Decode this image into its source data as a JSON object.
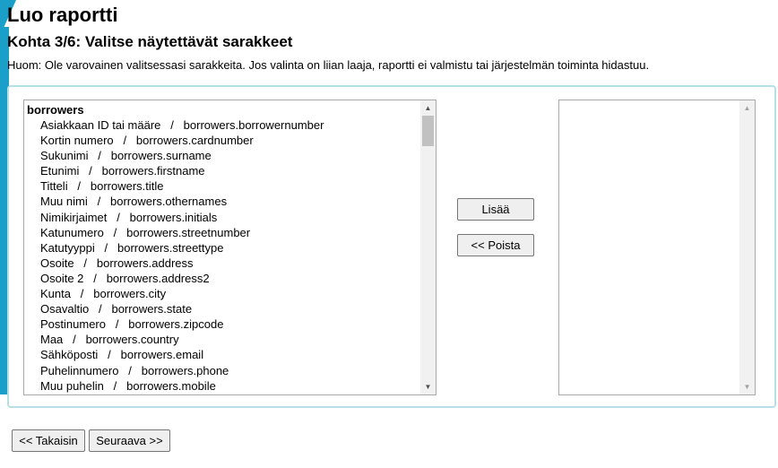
{
  "page": {
    "title": "Luo raportti",
    "step_title": "Kohta 3/6: Valitse näytettävät sarakkeet",
    "note": "Huom: Ole varovainen valitsessasi sarakkeita. Jos valinta on liian laaja, raportti ei valmistu tai järjestelmän toiminta hidastuu."
  },
  "available_columns": {
    "group_label": "borrowers",
    "options": [
      "Asiakkaan ID tai määre   /   borrowers.borrowernumber",
      "Kortin numero   /   borrowers.cardnumber",
      "Sukunimi   /   borrowers.surname",
      "Etunimi   /   borrowers.firstname",
      "Titteli   /   borrowers.title",
      "Muu nimi   /   borrowers.othernames",
      "Nimikirjaimet   /   borrowers.initials",
      "Katunumero   /   borrowers.streetnumber",
      "Katutyyppi   /   borrowers.streettype",
      "Osoite   /   borrowers.address",
      "Osoite 2   /   borrowers.address2",
      "Kunta   /   borrowers.city",
      "Osavaltio   /   borrowers.state",
      "Postinumero   /   borrowers.zipcode",
      "Maa   /   borrowers.country",
      "Sähköposti   /   borrowers.email",
      "Puhelinnumero   /   borrowers.phone",
      "Muu puhelin   /   borrowers.mobile"
    ]
  },
  "selected_columns": {
    "options": []
  },
  "buttons": {
    "add": "Lisää",
    "remove": "<< Poista",
    "back": "<< Takaisin",
    "next": "Seuraava >>"
  },
  "colors": {
    "accent": "#1aa0c8",
    "panel_border": "#b9dfe6"
  }
}
